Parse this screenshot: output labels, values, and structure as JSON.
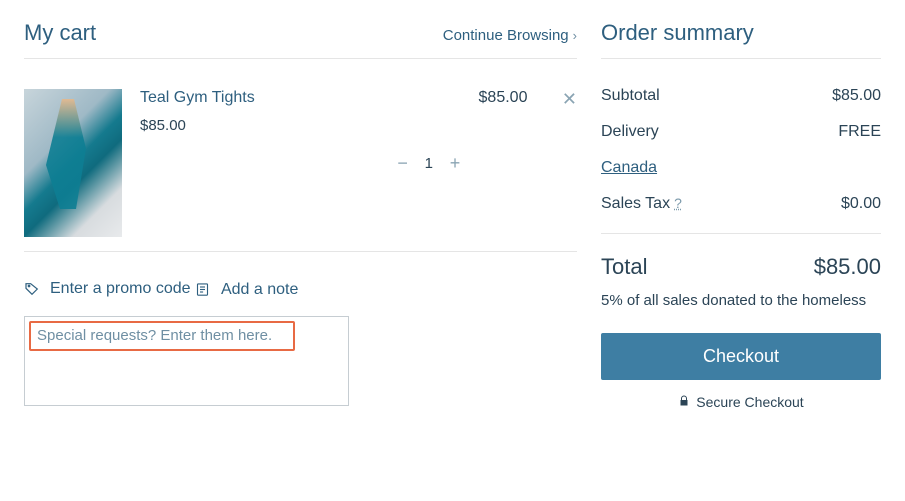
{
  "cart": {
    "title": "My cart",
    "continue_label": "Continue Browsing",
    "items": [
      {
        "name": "Teal Gym Tights",
        "price": "$85.00",
        "qty": "1",
        "line_total": "$85.00"
      }
    ],
    "promo_label": "Enter a promo code",
    "note_label": "Add a note",
    "note_placeholder": "Special requests? Enter them here."
  },
  "summary": {
    "title": "Order summary",
    "subtotal_label": "Subtotal",
    "subtotal_value": "$85.00",
    "delivery_label": "Delivery",
    "delivery_value": "FREE",
    "country": "Canada",
    "tax_label": "Sales Tax",
    "tax_help": "?",
    "tax_value": "$0.00",
    "total_label": "Total",
    "total_value": "$85.00",
    "donation_text": "5% of all sales donated to the homeless",
    "checkout_label": "Checkout",
    "secure_label": "Secure Checkout"
  }
}
